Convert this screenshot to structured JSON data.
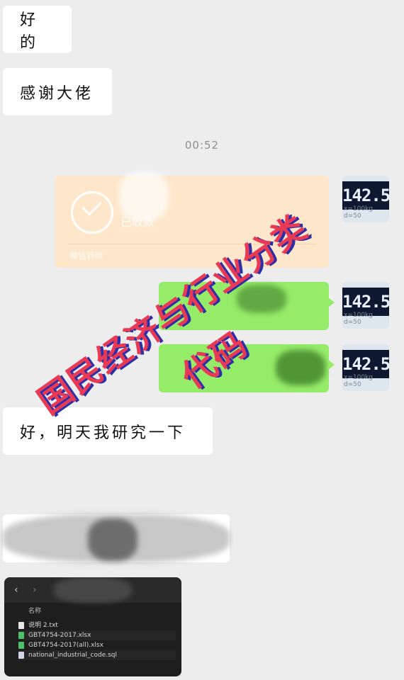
{
  "messages": [
    {
      "id": "m1",
      "text": "好的"
    },
    {
      "id": "m2",
      "text": "感谢大佬"
    },
    {
      "id": "m3",
      "text": "好，明天我研究一下"
    }
  ],
  "timestamp": "00:52",
  "transfer": {
    "status": "已收款",
    "footer": "微信转账"
  },
  "avatar": {
    "display": "142.5",
    "small": "26",
    "caption": "x=100kg d=50"
  },
  "watermark": {
    "line1": "国民经济与行业分类",
    "line2": "代码"
  },
  "finder": {
    "column_header": "名称",
    "files": [
      {
        "name": "说明 2.txt",
        "type": "txt"
      },
      {
        "name": "GBT4754-2017.xlsx",
        "type": "xlsx"
      },
      {
        "name": "GBT4754-2017(all).xlsx",
        "type": "xlsx"
      },
      {
        "name": "national_industrial_code.sql",
        "type": "sql"
      }
    ]
  },
  "colors": {
    "background": "#ededed",
    "incoming_bubble": "#ffffff",
    "outgoing_bubble": "#95ec69",
    "transfer_bubble": "#fde6c9",
    "watermark": "#e83a55",
    "watermark_shadow": "#2c2fa8"
  }
}
